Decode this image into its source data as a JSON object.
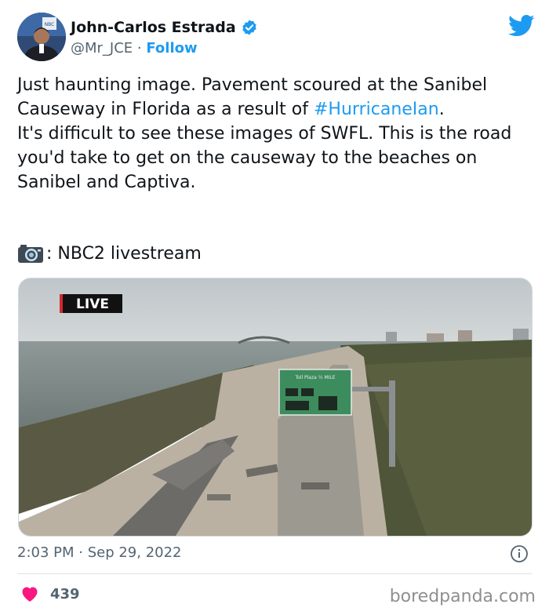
{
  "tweet": {
    "author": {
      "display_name": "John-Carlos Estrada",
      "handle": "@Mr_JCE",
      "separator": " · ",
      "follow_label": "Follow",
      "verified": true,
      "avatar_badge": "NBC"
    },
    "body": {
      "line1": "Just haunting image. Pavement scoured at the Sanibel Causeway in Florida as a result of ",
      "hashtag": "#HurricaneIan",
      "line1_end": ".",
      "line2": "It's difficult to see these images of SWFL. This is the road you'd take to get on the causeway to the beaches on Sanibel and Captiva.",
      "source_suffix": ": NBC2 livestream"
    },
    "media": {
      "live_badge": "LIVE",
      "sign_text": "Toll Plaza ½ MILE"
    },
    "timestamp": "2:03 PM · Sep 29, 2022",
    "likes": "439"
  },
  "watermark": "boredpanda.com",
  "colors": {
    "accent": "#1d9bf0",
    "like": "#f91880",
    "secondary_text": "#536471"
  },
  "icons": [
    "twitter-bird-icon",
    "verified-badge-icon",
    "camera-icon",
    "info-icon",
    "heart-icon"
  ]
}
